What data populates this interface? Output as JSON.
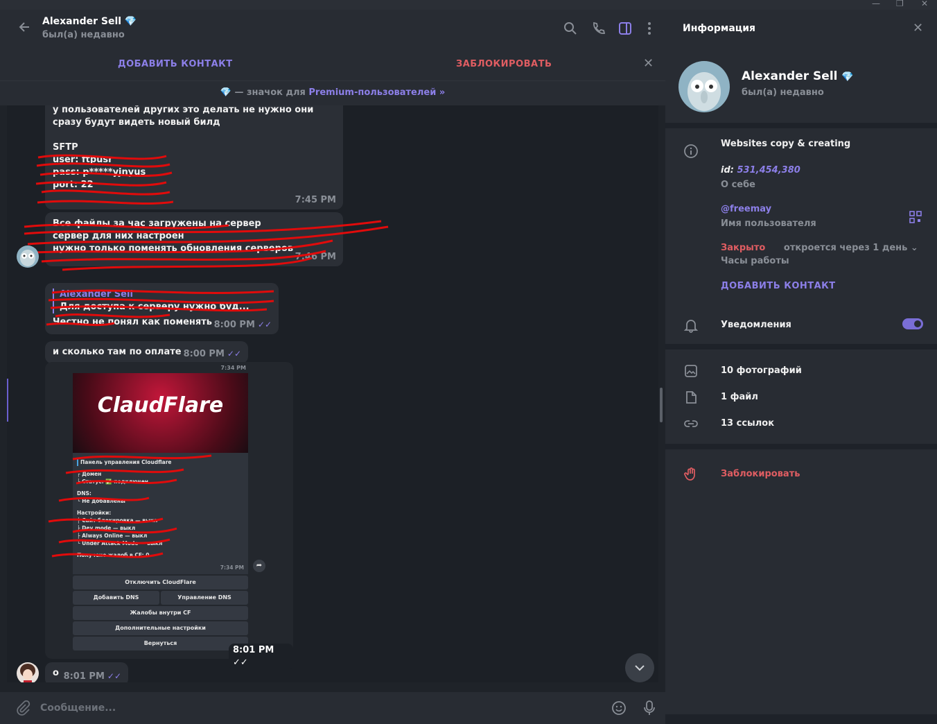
{
  "window": {
    "minimize": "—",
    "restore": "❐",
    "close": "✕"
  },
  "header": {
    "peer_name": "Alexander Sell",
    "peer_status": "был(а) недавно",
    "icons": [
      "back-arrow-icon",
      "search-icon",
      "phone-icon",
      "sidebar-toggle-icon",
      "more-vertical-icon"
    ]
  },
  "action_bar": {
    "add_contact": "ДОБАВИТЬ КОНТАКТ",
    "block": "ЗАБЛОКИРОВАТЬ",
    "add_color": "#8c7fe8",
    "block_color": "#e05d62"
  },
  "premium_bar": {
    "prefix": "— значок для ",
    "link": "Premium-пользователей »"
  },
  "messages": {
    "m1_line1": "у пользователей других это делать не нужно они",
    "m1_line2": "сразу будут видеть новый билд",
    "m1_sftp": "SFTP",
    "m1_user": "user: ftpusr",
    "m1_pass": "pass: p*****yjnyus",
    "m1_port": "port: 22",
    "m1_time": "7:45 PM",
    "m2_line1": "Все файлы за час загружены на сервер",
    "m2_line2": "сервер для них настроен",
    "m2_line3": "нужно только поменять обновления серверов",
    "m2_time": "7:46 PM",
    "m3_reply_name": "Alexander Sell",
    "m3_reply_text": "Для доступа к серверу нужно буд...",
    "m3_text": "Честно не понял как поменять",
    "m3_time": "8:00 PM",
    "m4_text": "и сколько там по оплате",
    "m4_time": "8:00 PM",
    "m5_time": "8:01 PM",
    "m6_text": "о",
    "m6_time": "8:01 PM"
  },
  "forward": {
    "inner_time": "7:34 PM",
    "banner_title": "ClaudFlare",
    "panel_title": "Панель управления Cloudflare",
    "domain": "┌ Домен",
    "status": "└ Статус: ✅ подключен",
    "dns": "DNS:",
    "dns_empty": "└ Не добавлены",
    "settings": "Настройки:",
    "s1": "├ Сайт блокировка — выкл",
    "s2": "├ Dev mode — выкл",
    "s3": "├ Always Online — выкл",
    "s4": "└ Under Attack Mode — выкл",
    "complaints": "Получено жалоб в CF: 0",
    "card_time": "7:34 PM",
    "btn_disable": "Отключить CloudFlare",
    "btn_add_dns": "Добавить DNS",
    "btn_manage_dns": "Управление DNS",
    "btn_complaints": "Жалобы внутри CF",
    "btn_extra": "Дополнительные настройки",
    "btn_back": "Вернуться"
  },
  "composer": {
    "placeholder": "Сообщение..."
  },
  "panel": {
    "title": "Информация",
    "name": "Alexander Sell",
    "status": "был(а) недавно",
    "bio": "Websites copy & creating",
    "id_label": "id:",
    "id_value": "531,454,380",
    "about_label": "О себе",
    "username": "@freemay",
    "username_label": "Имя пользователя",
    "hours_status": "Закрыто",
    "hours_note": "откроется через 1 день",
    "hours_label": "Часы работы",
    "add_contact": "ДОБАВИТЬ КОНТАКТ",
    "notifications": "Уведомления",
    "notifications_on": true,
    "photos": "10 фотографий",
    "files": "1 файл",
    "links": "13 ссылок",
    "block": "Заблокировать"
  }
}
